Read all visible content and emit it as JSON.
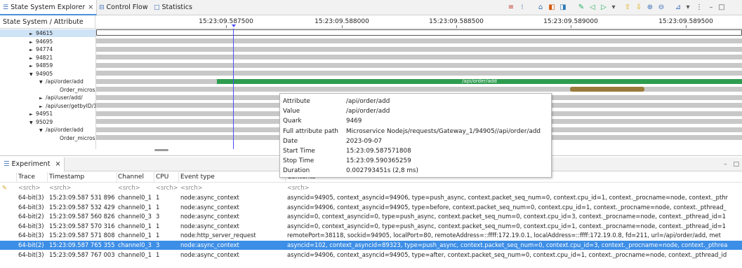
{
  "top": {
    "tabs": [
      {
        "label": "State System Explorer",
        "icon": "list-icon",
        "closable": true
      },
      {
        "label": "Control Flow",
        "icon": "control-flow-icon"
      },
      {
        "label": "Statistics",
        "icon": "statistics-icon"
      }
    ],
    "close_glyph": "×",
    "tree_header": "State System / Attribute",
    "time_ticks": [
      "15:23:09.587500",
      "15:23:09.588000",
      "15:23:09.588500",
      "15:23:09.589000",
      "15:23:09.589500"
    ],
    "tree_rows": [
      {
        "label": "94615",
        "indent": 3,
        "toggle": "►",
        "selected": true
      },
      {
        "label": "94695",
        "indent": 3,
        "toggle": "►"
      },
      {
        "label": "94774",
        "indent": 3,
        "toggle": "►"
      },
      {
        "label": "94821",
        "indent": 3,
        "toggle": "►"
      },
      {
        "label": "94859",
        "indent": 3,
        "toggle": "►"
      },
      {
        "label": "94905",
        "indent": 3,
        "toggle": "▼"
      },
      {
        "label": "/api/order/add",
        "indent": 4,
        "toggle": "▼"
      },
      {
        "label": "Order_microservice",
        "indent": 5,
        "toggle": ""
      },
      {
        "label": "/api/user/add/",
        "indent": 4,
        "toggle": "►"
      },
      {
        "label": "/api/user/getbyID/1",
        "indent": 4,
        "toggle": "►"
      },
      {
        "label": "94951",
        "indent": 3,
        "toggle": "►"
      },
      {
        "label": "95029",
        "indent": 3,
        "toggle": "▼"
      },
      {
        "label": "/api/order/add",
        "indent": 4,
        "toggle": "▼"
      },
      {
        "label": "Order_microservice",
        "indent": 5,
        "toggle": ""
      }
    ],
    "green_bar_label": "/api/order/add",
    "colors": {
      "green": "#2e9c4f",
      "brown": "#9a7b3a",
      "lane": "#c8c8c8",
      "cursor": "#4d4dff",
      "selection": "#3d8ee6"
    }
  },
  "tooltip": {
    "rows": [
      {
        "key": "Attribute",
        "value": "/api/order/add"
      },
      {
        "key": "Value",
        "value": "/api/order/add"
      },
      {
        "key": "Quark",
        "value": "9469"
      },
      {
        "key": "Full attribute path",
        "value": "Microservice Nodejs/requests/Gateway_1/94905//api/order/add"
      },
      {
        "key": "Date",
        "value": "2023-09-07"
      },
      {
        "key": "Start Time",
        "value": "15:23:09.587571808"
      },
      {
        "key": "Stop Time",
        "value": "15:23:09.590365259"
      },
      {
        "key": "Duration",
        "value": "0.002793451s (2,8 ms)"
      }
    ]
  },
  "experiment": {
    "tab_label": "Experiment",
    "columns": [
      "",
      "Trace",
      "Timestamp",
      "Channel",
      "CPU",
      "Event type",
      "Contents"
    ],
    "filter_placeholder": "<srch>",
    "rows": [
      {
        "trace": "64-bit(3)",
        "timestamp": "15:23:09.587 531 896",
        "channel": "channel0_1",
        "cpu": "1",
        "event": "node:async_context",
        "contents": "asyncid=94905, context_asyncid=94906, type=push_async, context.packet_seq_num=0, context.cpu_id=1, context._procname=node, context._pthr"
      },
      {
        "trace": "64-bit(3)",
        "timestamp": "15:23:09.587 532 429",
        "channel": "channel0_1",
        "cpu": "1",
        "event": "node:async_context",
        "contents": "asyncid=94906, context_asyncid=94905, type=before, context.packet_seq_num=0, context.cpu_id=1, context._procname=node, context._pthread_"
      },
      {
        "trace": "64-bit(2)",
        "timestamp": "15:23:09.587 560 826",
        "channel": "channel0_3",
        "cpu": "3",
        "event": "node:async_context",
        "contents": "asyncid=0, context_asyncid=0, type=push_async, context.packet_seq_num=0, context.cpu_id=3, context._procname=node, context._pthread_id=1"
      },
      {
        "trace": "64-bit(3)",
        "timestamp": "15:23:09.587 570 316",
        "channel": "channel0_1",
        "cpu": "1",
        "event": "node:async_context",
        "contents": "asyncid=0, context_asyncid=0, type=push_async, context.packet_seq_num=0, context.cpu_id=1, context._procname=node, context._pthread_id=1"
      },
      {
        "trace": "64-bit(3)",
        "timestamp": "15:23:09.587 571 808",
        "channel": "channel0_1",
        "cpu": "1",
        "event": "node:http_server_request",
        "contents": "remotePort=38118, sockid=94905, localPort=80, remoteAddress=::ffff:172.19.0.1, localAddress=::ffff:172.19.0.8, fd=211, url=/api/order/add, met"
      },
      {
        "trace": "64-bit(2)",
        "timestamp": "15:23:09.587 765 355",
        "channel": "channel0_3",
        "cpu": "3",
        "event": "node:async_context",
        "contents": "asyncid=102, context_asyncid=89323, type=push_async, context.packet_seq_num=0, context.cpu_id=3, context._procname=node, context._pthrea",
        "selected": true
      },
      {
        "trace": "64-bit(3)",
        "timestamp": "15:23:09.587 767 003",
        "channel": "channel0_1",
        "cpu": "1",
        "event": "node:async_context",
        "contents": "asyncid=94906, context_asyncid=94905, type=after, context.packet_seq_num=0, context.cpu_id=1, context._procname=node, context._pthread_id"
      }
    ]
  }
}
